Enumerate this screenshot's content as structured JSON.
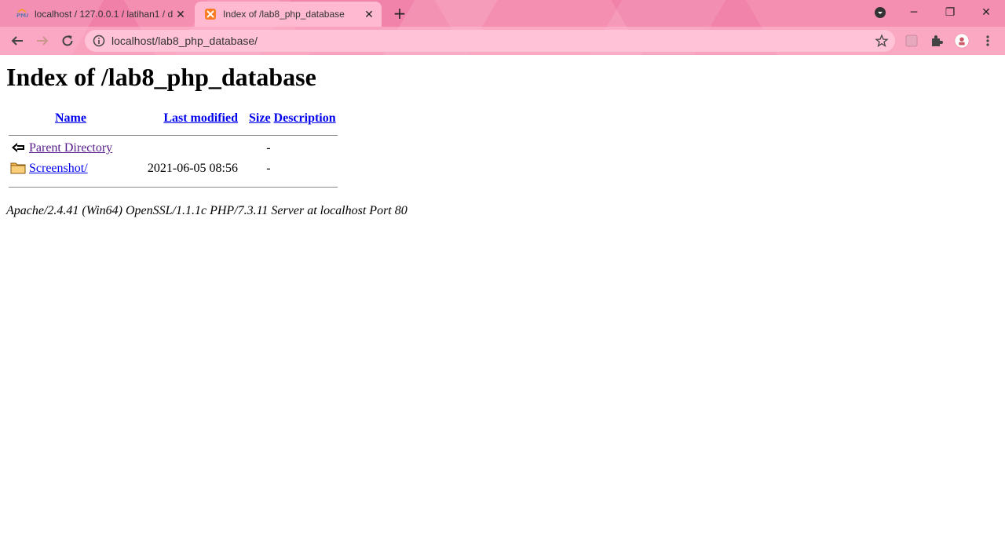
{
  "browser": {
    "tabs": [
      {
        "title": "localhost / 127.0.0.1 / latihan1 / d",
        "favicon": "phpmyadmin-icon",
        "active": false
      },
      {
        "title": "Index of /lab8_php_database",
        "favicon": "xampp-icon",
        "active": true
      }
    ],
    "new_tab_label": "+",
    "url": "localhost/lab8_php_database/",
    "theme_color": "#f58fb2"
  },
  "page": {
    "heading": "Index of /lab8_php_database",
    "columns": {
      "name": "Name",
      "last_modified": "Last modified",
      "size": "Size",
      "description": "Description"
    },
    "rows": [
      {
        "icon": "back-icon",
        "name": "Parent Directory",
        "last_modified": "",
        "size": "-",
        "description": ""
      },
      {
        "icon": "folder-icon",
        "name": "Screenshot/",
        "last_modified": "2021-06-05 08:56",
        "size": "-",
        "description": ""
      }
    ],
    "footer": "Apache/2.4.41 (Win64) OpenSSL/1.1.1c PHP/7.3.11 Server at localhost Port 80"
  }
}
